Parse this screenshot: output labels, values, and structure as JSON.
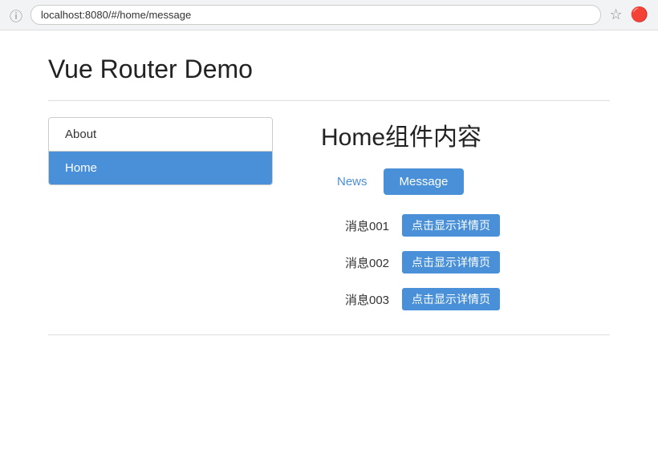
{
  "browser": {
    "url": "localhost:8080/#/home/message",
    "info_icon": "ⓘ",
    "star_icon": "☆",
    "ext_icon": "🔴"
  },
  "page": {
    "title": "Vue Router Demo"
  },
  "sidebar": {
    "items": [
      {
        "id": "about",
        "label": "About",
        "active": false
      },
      {
        "id": "home",
        "label": "Home",
        "active": true
      }
    ]
  },
  "main": {
    "heading": "Home组件内容",
    "tabs": [
      {
        "id": "news",
        "label": "News",
        "active": false
      },
      {
        "id": "message",
        "label": "Message",
        "active": true
      }
    ],
    "messages": [
      {
        "id": "msg1",
        "text": "消息001",
        "btn_label": "点击显示详情页"
      },
      {
        "id": "msg2",
        "text": "消息002",
        "btn_label": "点击显示详情页"
      },
      {
        "id": "msg3",
        "text": "消息003",
        "btn_label": "点击显示详情页"
      }
    ]
  }
}
